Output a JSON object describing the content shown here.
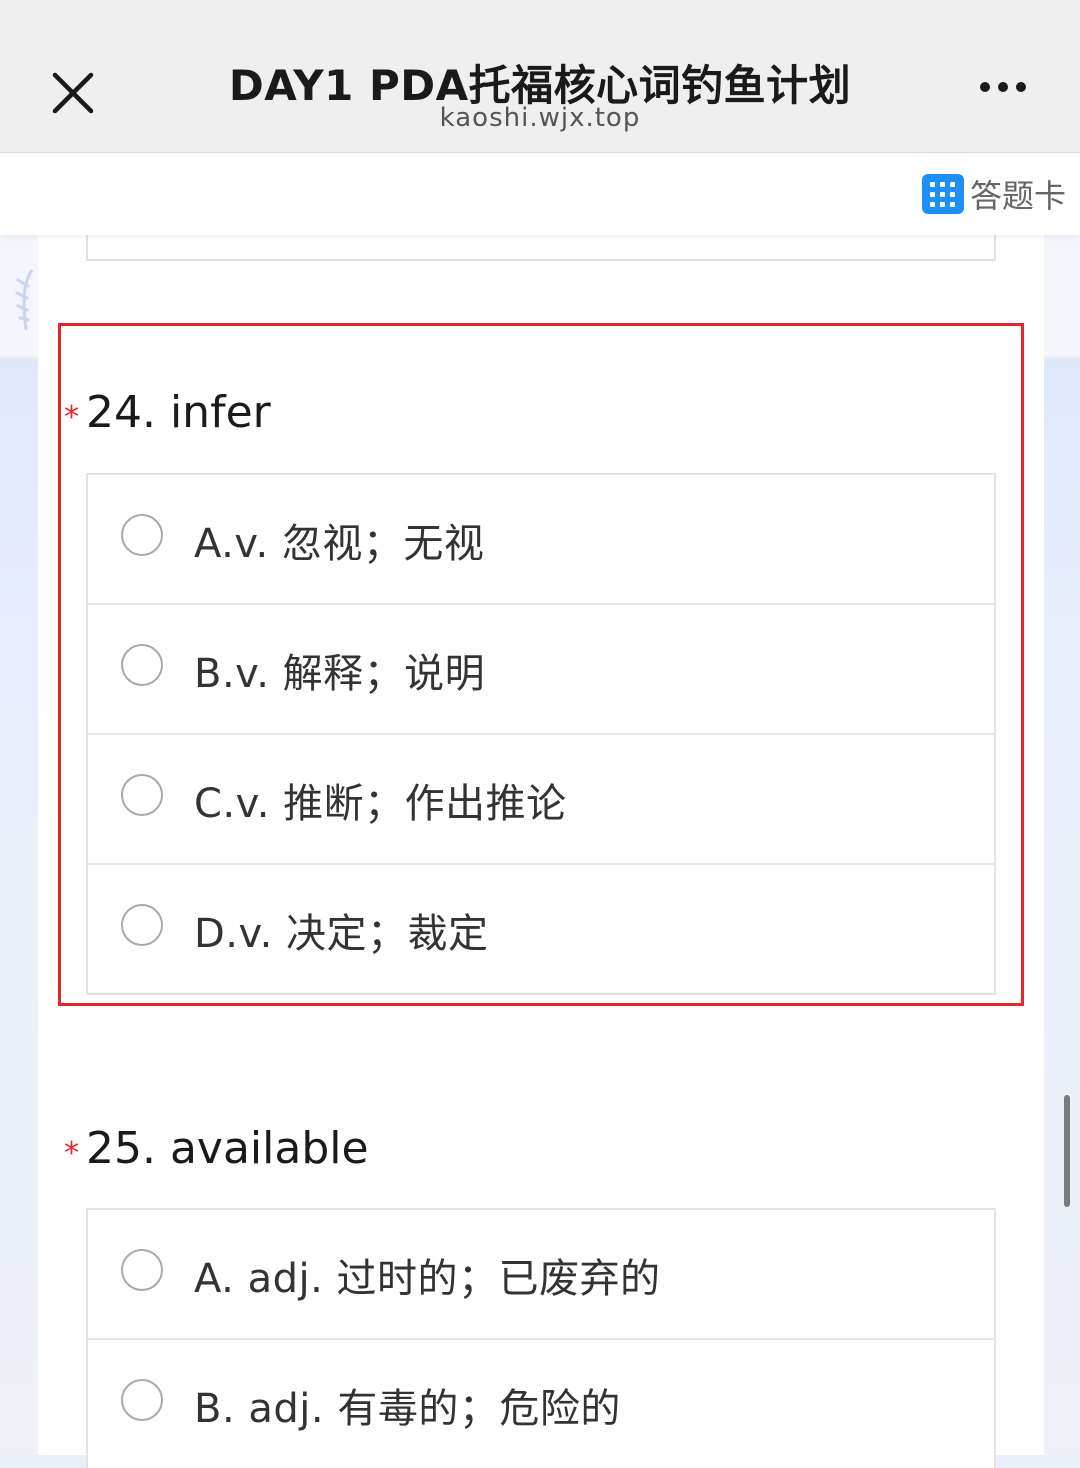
{
  "header": {
    "title": "DAY1 PDA托福核心词钓鱼计划",
    "domain": "kaoshi.wjx.top",
    "close_icon": "close-icon",
    "more_icon": "more-dots-icon"
  },
  "toolbar": {
    "answer_card_label": "答题卡",
    "answer_card_icon": "grid-icon",
    "accent_color": "#1e8ff6"
  },
  "questions": [
    {
      "required_mark": "*",
      "title": "24. infer",
      "highlighted": true,
      "highlight_color": "#e8252a",
      "options": [
        {
          "label": "A.v. 忽视；无视"
        },
        {
          "label": "B.v. 解释；说明"
        },
        {
          "label": "C.v. 推断；作出推论"
        },
        {
          "label": "D.v. 决定；裁定"
        }
      ]
    },
    {
      "required_mark": "*",
      "title": "25. available",
      "highlighted": false,
      "options": [
        {
          "label": "A. adj. 过时的；已废弃的"
        },
        {
          "label": "B. adj. 有毒的；危险的"
        }
      ]
    }
  ]
}
